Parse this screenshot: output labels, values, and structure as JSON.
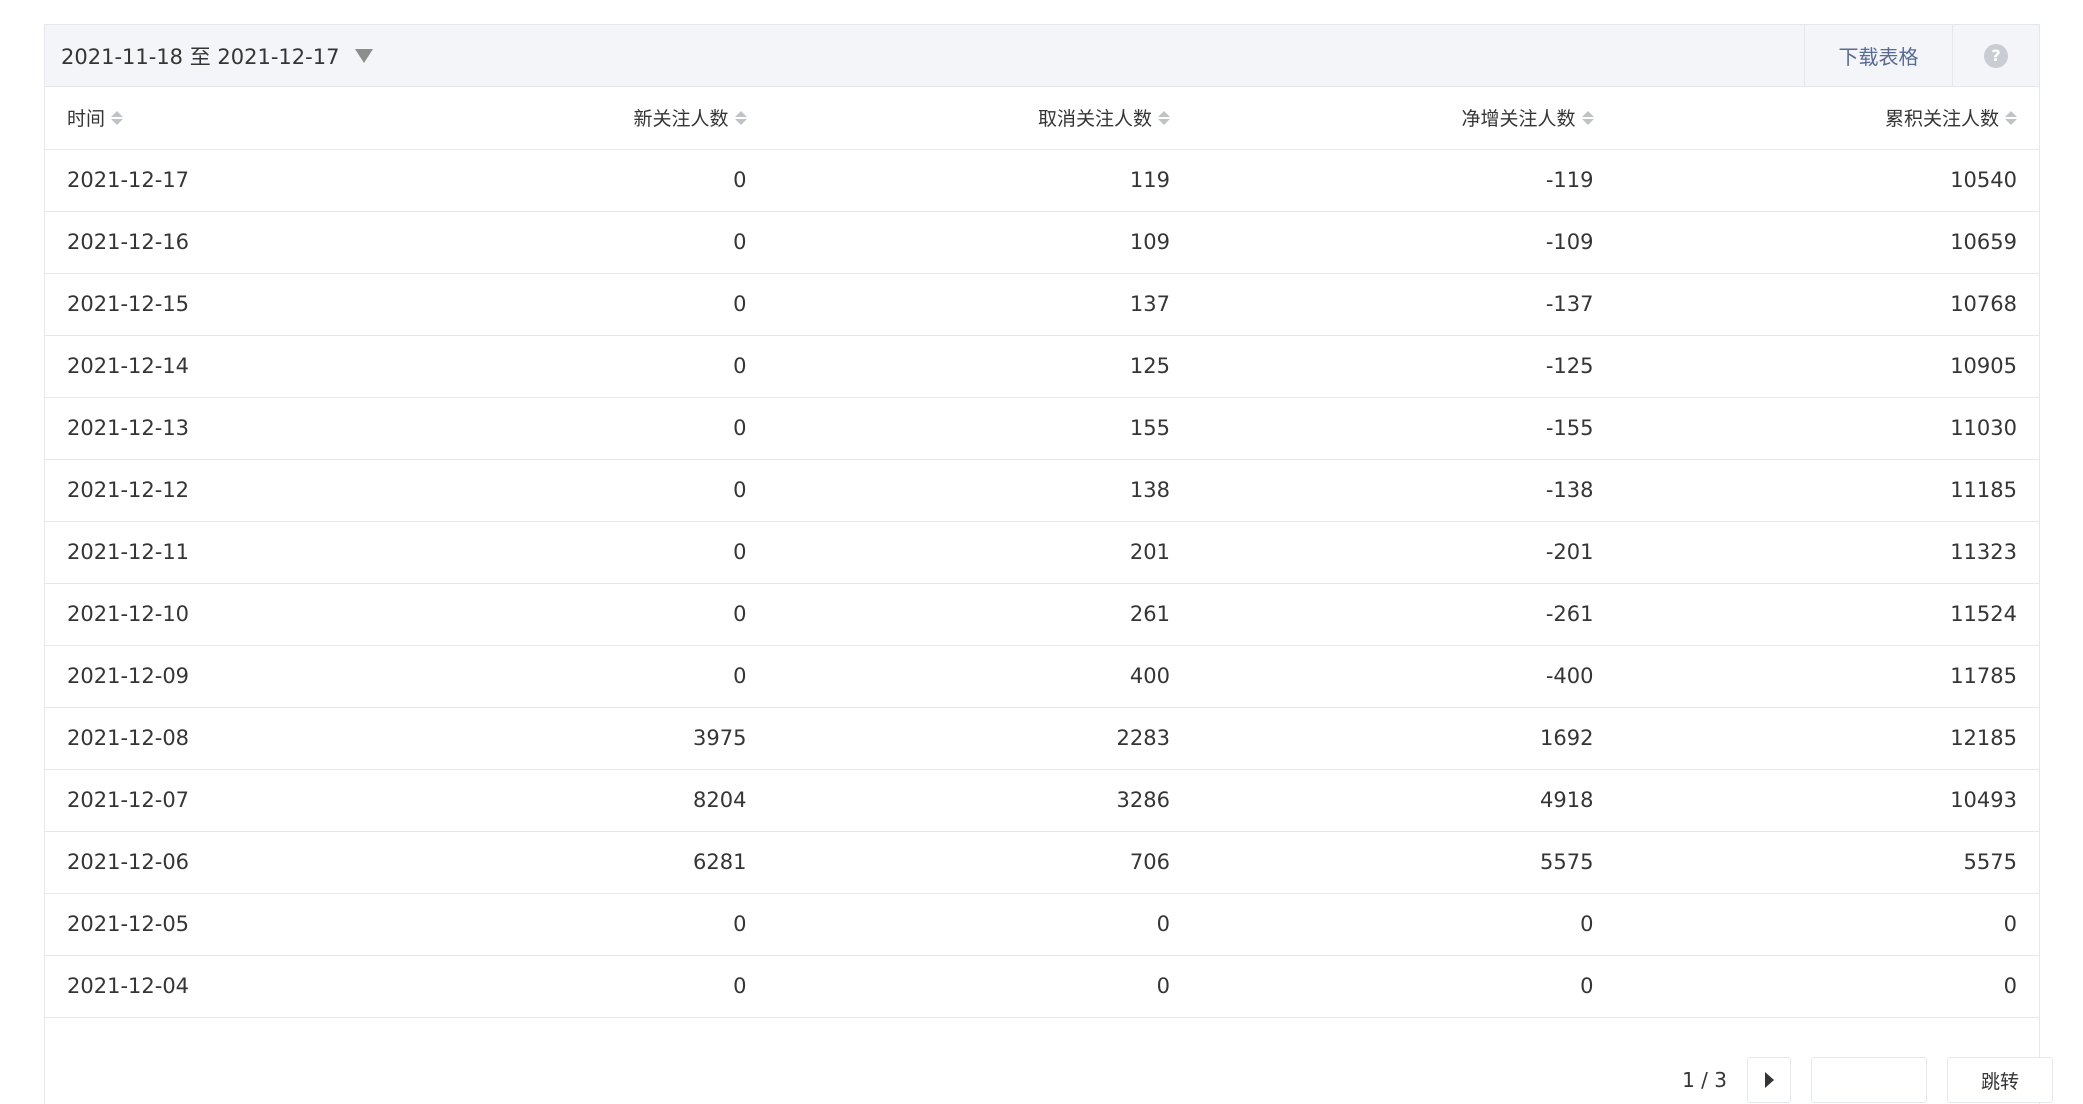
{
  "toolbar": {
    "date_range": "2021-11-18 至 2021-12-17",
    "download_label": "下载表格",
    "help_glyph": "?"
  },
  "table": {
    "headers": [
      "时间",
      "新关注人数",
      "取消关注人数",
      "净增关注人数",
      "累积关注人数"
    ],
    "rows": [
      [
        "2021-12-17",
        "0",
        "119",
        "-119",
        "10540"
      ],
      [
        "2021-12-16",
        "0",
        "109",
        "-109",
        "10659"
      ],
      [
        "2021-12-15",
        "0",
        "137",
        "-137",
        "10768"
      ],
      [
        "2021-12-14",
        "0",
        "125",
        "-125",
        "10905"
      ],
      [
        "2021-12-13",
        "0",
        "155",
        "-155",
        "11030"
      ],
      [
        "2021-12-12",
        "0",
        "138",
        "-138",
        "11185"
      ],
      [
        "2021-12-11",
        "0",
        "201",
        "-201",
        "11323"
      ],
      [
        "2021-12-10",
        "0",
        "261",
        "-261",
        "11524"
      ],
      [
        "2021-12-09",
        "0",
        "400",
        "-400",
        "11785"
      ],
      [
        "2021-12-08",
        "3975",
        "2283",
        "1692",
        "12185"
      ],
      [
        "2021-12-07",
        "8204",
        "3286",
        "4918",
        "10493"
      ],
      [
        "2021-12-06",
        "6281",
        "706",
        "5575",
        "5575"
      ],
      [
        "2021-12-05",
        "0",
        "0",
        "0",
        "0"
      ],
      [
        "2021-12-04",
        "0",
        "0",
        "0",
        "0"
      ]
    ]
  },
  "pager": {
    "page_info": "1 / 3",
    "jump_label": "跳转",
    "input_value": ""
  },
  "colors": {
    "link": "#576b95",
    "toolbar_bg": "#f4f5f9",
    "border": "#e4e8eb",
    "text": "#353535"
  },
  "icons": {
    "dropdown": "caret-down-icon",
    "help": "question-circle-icon",
    "sort": "sort-icon",
    "next": "next-page-icon"
  }
}
